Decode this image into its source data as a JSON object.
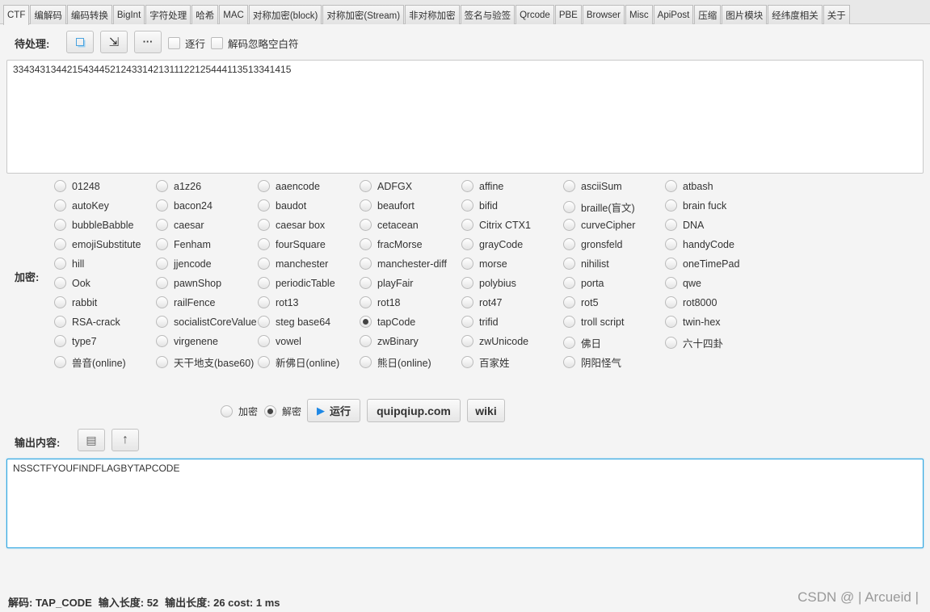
{
  "tabs": [
    "CTF",
    "编解码",
    "编码转换",
    "BigInt",
    "字符处理",
    "哈希",
    "MAC",
    "对称加密(block)",
    "对称加密(Stream)",
    "非对称加密",
    "签名与验签",
    "Qrcode",
    "PBE",
    "Browser",
    "Misc",
    "ApiPost",
    "压缩",
    "图片模块",
    "经纬度相关",
    "关于"
  ],
  "active_tab": "CTF",
  "input": {
    "label": "待处理:",
    "line_by_line": "逐行",
    "ignore_whitespace": "解码忽略空白符",
    "more": "···",
    "value": "3343431344215434452124331421311122125444113513341415"
  },
  "cipher": {
    "label": "加密:",
    "selected": "tapCode",
    "options": [
      "01248",
      "a1z26",
      "aaencode",
      "ADFGX",
      "affine",
      "asciiSum",
      "atbash",
      "autoKey",
      "bacon24",
      "baudot",
      "beaufort",
      "bifid",
      "braille(盲文)",
      "brain fuck",
      "bubbleBabble",
      "caesar",
      "caesar box",
      "cetacean",
      "Citrix CTX1",
      "curveCipher",
      "DNA",
      "emojiSubstitute",
      "Fenham",
      "fourSquare",
      "fracMorse",
      "grayCode",
      "gronsfeld",
      "handyCode",
      "hill",
      "jjencode",
      "manchester",
      "manchester-diff",
      "morse",
      "nihilist",
      "oneTimePad",
      "Ook",
      "pawnShop",
      "periodicTable",
      "playFair",
      "polybius",
      "porta",
      "qwe",
      "rabbit",
      "railFence",
      "rot13",
      "rot18",
      "rot47",
      "rot5",
      "rot8000",
      "RSA-crack",
      "socialistCoreValue",
      "steg base64",
      "tapCode",
      "trifid",
      "troll script",
      "twin-hex",
      "type7",
      "virgenene",
      "vowel",
      "zwBinary",
      "zwUnicode",
      "佛日",
      "六十四卦",
      "兽音(online)",
      "天干地支(base60)",
      "新佛日(online)",
      "熊日(online)",
      "百家姓",
      "阴阳怪气"
    ]
  },
  "actions": {
    "encrypt": "加密",
    "decrypt": "解密",
    "mode": "解密",
    "run": "运行",
    "quipqiup": "quipqiup.com",
    "wiki": "wiki"
  },
  "output": {
    "label": "输出内容:",
    "value": "NSSCTFYOUFINDFLAGBYTAPCODE"
  },
  "status": {
    "decode": "解码: TAP_CODE",
    "input_len": "输入长度: 52",
    "output_len": "输出长度: 26 cost: 1 ms"
  },
  "watermark": "CSDN @ | Arcueid |",
  "colors": {
    "accent": "#29a3e0",
    "run_icon": "#1e88e5"
  }
}
